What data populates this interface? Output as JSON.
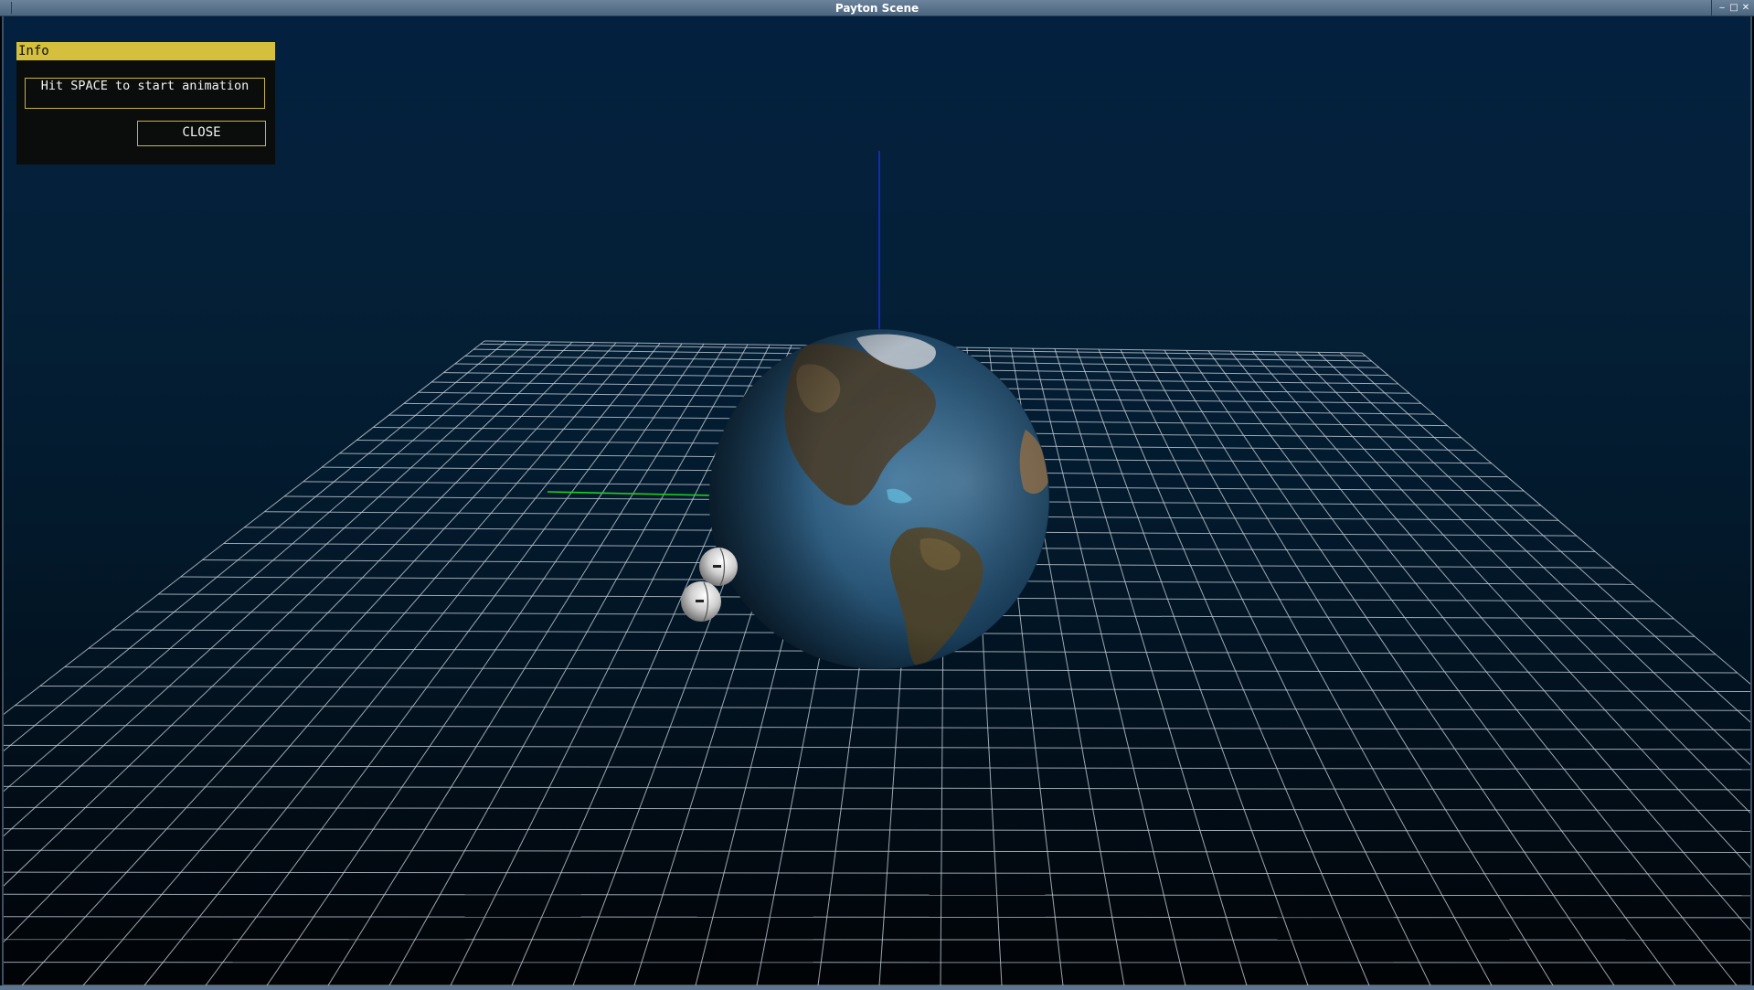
{
  "window": {
    "title": "Payton Scene",
    "controls": {
      "minimize": "‒",
      "maximize": "□",
      "close": "✕"
    }
  },
  "info_panel": {
    "title": "Info",
    "message": "Hit SPACE to start animation",
    "close_label": "CLOSE"
  },
  "scene": {
    "background_top": "#03213f",
    "background_bottom": "#010306",
    "grid_color": "#c8d2dc",
    "z_axis_color": "#1a2dd6",
    "x_axis_color": "#1fd11f",
    "accent": "#d4c03c",
    "objects": [
      "earth-globe",
      "grid-floor",
      "z-axis-line",
      "y-axis-line",
      "small-sphere",
      "small-sphere"
    ]
  }
}
